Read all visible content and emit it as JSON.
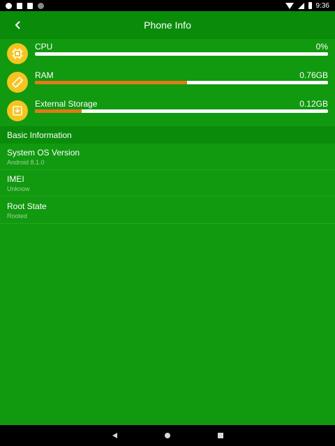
{
  "status_bar": {
    "time": "9:36",
    "left_icons": [
      "notification-icon",
      "app-icon",
      "sd-card-icon",
      "sync-icon"
    ],
    "right_icons": [
      "wifi-icon",
      "signal-icon",
      "battery-icon"
    ]
  },
  "toolbar": {
    "title": "Phone Info",
    "back_icon": "back-arrow-icon"
  },
  "resources": [
    {
      "label": "CPU",
      "value": "0%",
      "fraction": 0.0,
      "icon": "cpu-icon"
    },
    {
      "label": "RAM",
      "value": "0.76GB",
      "fraction": 0.52,
      "icon": "ram-icon"
    },
    {
      "label": "External Storage",
      "value": "0.12GB",
      "fraction": 0.16,
      "icon": "storage-icon"
    }
  ],
  "section": {
    "title": "Basic Information"
  },
  "info": [
    {
      "title": "System OS Version",
      "value": "Android 8.1.0"
    },
    {
      "title": "IMEI",
      "value": "Unknow"
    },
    {
      "title": "Root State",
      "value": "Rooted"
    }
  ],
  "colors": {
    "background": "#119910",
    "toolbar": "#0a8c0a",
    "icon_circle": "#f5c41f",
    "bar_fill": "#e07b16",
    "bar_track": "#ffffff"
  },
  "nav_bar": {
    "buttons": [
      "back-icon",
      "home-icon",
      "recents-icon"
    ]
  }
}
